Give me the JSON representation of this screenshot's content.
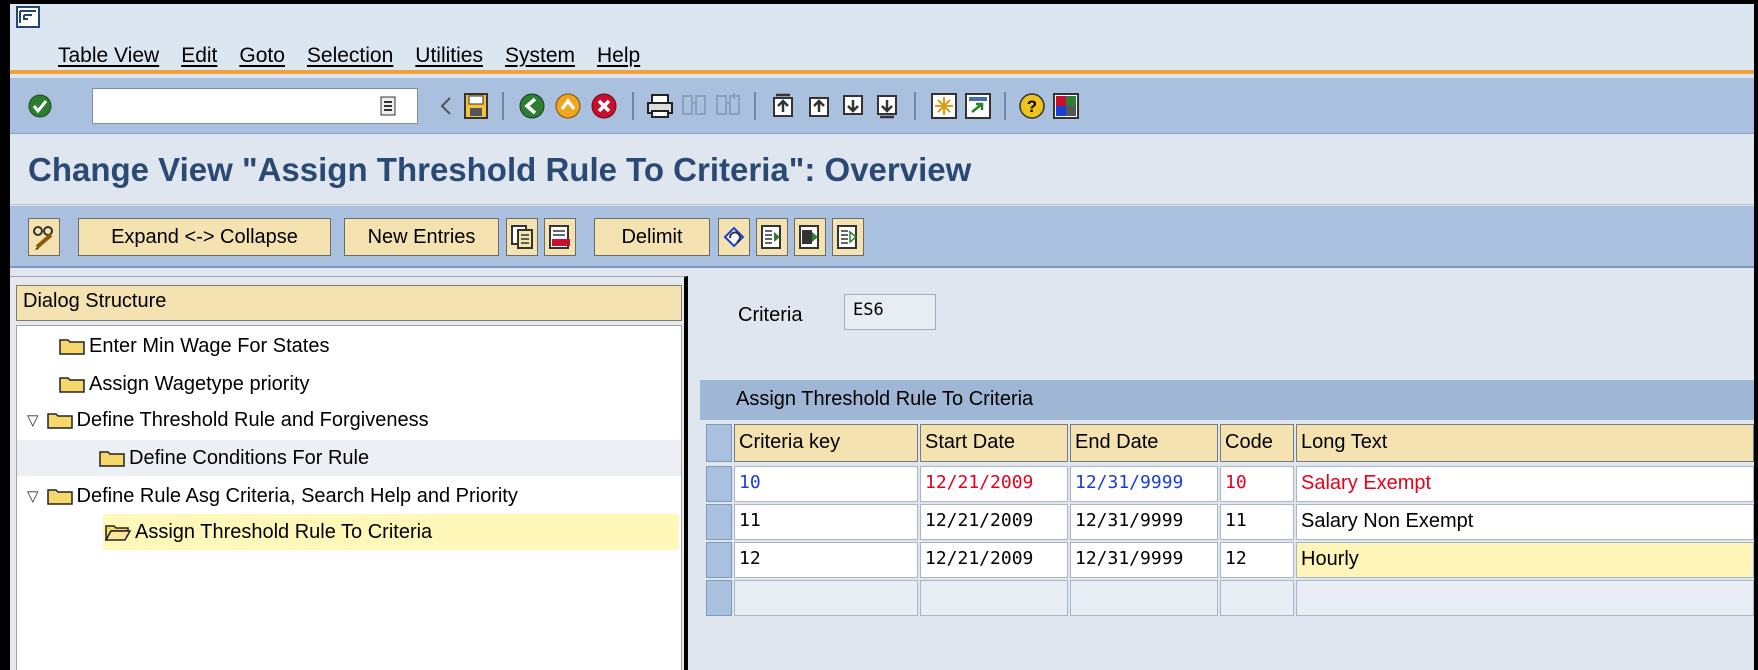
{
  "menu": {
    "items": [
      "Table View",
      "Edit",
      "Goto",
      "Selection",
      "Utilities",
      "System",
      "Help"
    ]
  },
  "toolbar": {
    "command_field_value": "",
    "icons": [
      "enter-icon",
      "history-icon",
      "back-arrow-icon",
      "save-icon",
      "back-icon",
      "exit-icon",
      "cancel-icon",
      "print-icon",
      "find-icon",
      "find-next-icon",
      "first-page-icon",
      "previous-page-icon",
      "next-page-icon",
      "last-page-icon",
      "new-session-icon",
      "shortcut-icon",
      "help-icon",
      "layout-icon"
    ]
  },
  "page": {
    "title": "Change View \"Assign Threshold Rule To Criteria\": Overview"
  },
  "app_toolbar": {
    "expand_collapse": "Expand <-> Collapse",
    "new_entries": "New Entries",
    "delimit": "Delimit"
  },
  "dialog_structure": {
    "header": "Dialog Structure",
    "nodes": [
      {
        "label": "Enter Min Wage For States",
        "level": 1,
        "expanded": false,
        "selected": false
      },
      {
        "label": "Assign Wagetype priority",
        "level": 1,
        "expanded": false,
        "selected": false
      },
      {
        "label": "Define Threshold Rule and Forgiveness",
        "level": 1,
        "expanded": true,
        "selected": false
      },
      {
        "label": "Define Conditions For Rule",
        "level": 2,
        "expanded": false,
        "selected": false
      },
      {
        "label": "Define Rule Asg Criteria, Search Help and Priority",
        "level": 1,
        "expanded": true,
        "selected": false
      },
      {
        "label": "Assign Threshold Rule To Criteria",
        "level": 2,
        "expanded": false,
        "selected": true
      }
    ]
  },
  "criteria": {
    "label": "Criteria",
    "value": "ES6"
  },
  "table": {
    "caption": "Assign Threshold Rule To Criteria",
    "columns": [
      "Criteria key",
      "Start Date",
      "End Date",
      "Code",
      "Long Text"
    ],
    "rows": [
      {
        "key": "10",
        "start": "12/21/2009",
        "end": "12/31/9999",
        "code": "10",
        "text": "Salary Exempt"
      },
      {
        "key": "11",
        "start": "12/21/2009",
        "end": "12/31/9999",
        "code": "11",
        "text": "Salary Non Exempt"
      },
      {
        "key": "12",
        "start": "12/21/2009",
        "end": "12/31/9999",
        "code": "12",
        "text": "Hourly"
      }
    ]
  },
  "colors": {
    "title": "#2a4a74",
    "toolbar": "#a9c0de",
    "button": "#f4e2b0",
    "accent_line": "#f2a03a",
    "red_text": "#e8001a",
    "blue_text": "#1a3ed8"
  }
}
